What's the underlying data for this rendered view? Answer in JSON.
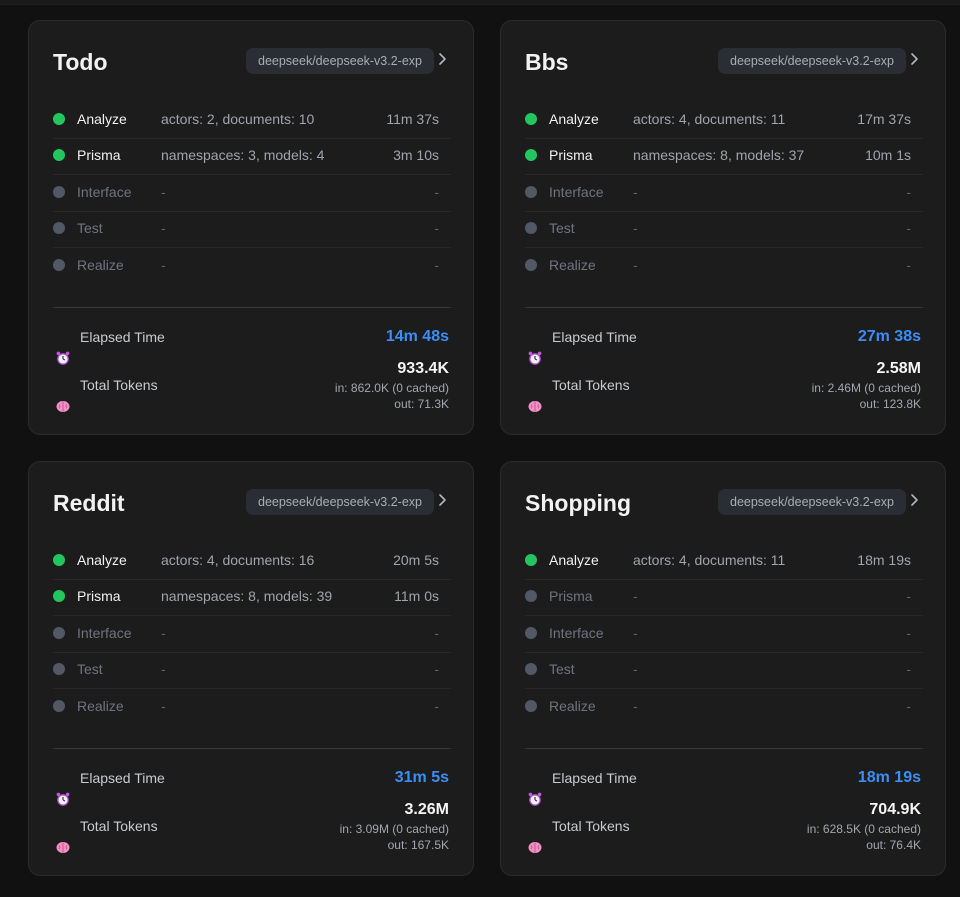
{
  "cards": [
    {
      "title": "Todo",
      "model": "deepseek/deepseek-v3.2-exp",
      "phases": [
        {
          "name": "Analyze",
          "detail": "actors: 2, documents: 10",
          "time": "11m 37s",
          "status": "done"
        },
        {
          "name": "Prisma",
          "detail": "namespaces: 3, models: 4",
          "time": "3m 10s",
          "status": "done"
        },
        {
          "name": "Interface",
          "detail": "-",
          "time": "-",
          "status": "pending"
        },
        {
          "name": "Test",
          "detail": "-",
          "time": "-",
          "status": "pending"
        },
        {
          "name": "Realize",
          "detail": "-",
          "time": "-",
          "status": "pending"
        }
      ],
      "elapsed_label": "Elapsed Time",
      "elapsed": "14m 48s",
      "tokens_label": "Total Tokens",
      "tokens_total": "933.4K",
      "tokens_in": "in: 862.0K (0 cached)",
      "tokens_out": "out: 71.3K"
    },
    {
      "title": "Bbs",
      "model": "deepseek/deepseek-v3.2-exp",
      "phases": [
        {
          "name": "Analyze",
          "detail": "actors: 4, documents: 11",
          "time": "17m 37s",
          "status": "done"
        },
        {
          "name": "Prisma",
          "detail": "namespaces: 8, models: 37",
          "time": "10m 1s",
          "status": "done"
        },
        {
          "name": "Interface",
          "detail": "-",
          "time": "-",
          "status": "pending"
        },
        {
          "name": "Test",
          "detail": "-",
          "time": "-",
          "status": "pending"
        },
        {
          "name": "Realize",
          "detail": "-",
          "time": "-",
          "status": "pending"
        }
      ],
      "elapsed_label": "Elapsed Time",
      "elapsed": "27m 38s",
      "tokens_label": "Total Tokens",
      "tokens_total": "2.58M",
      "tokens_in": "in: 2.46M (0 cached)",
      "tokens_out": "out: 123.8K"
    },
    {
      "title": "Reddit",
      "model": "deepseek/deepseek-v3.2-exp",
      "phases": [
        {
          "name": "Analyze",
          "detail": "actors: 4, documents: 16",
          "time": "20m 5s",
          "status": "done"
        },
        {
          "name": "Prisma",
          "detail": "namespaces: 8, models: 39",
          "time": "11m 0s",
          "status": "done"
        },
        {
          "name": "Interface",
          "detail": "-",
          "time": "-",
          "status": "pending"
        },
        {
          "name": "Test",
          "detail": "-",
          "time": "-",
          "status": "pending"
        },
        {
          "name": "Realize",
          "detail": "-",
          "time": "-",
          "status": "pending"
        }
      ],
      "elapsed_label": "Elapsed Time",
      "elapsed": "31m 5s",
      "tokens_label": "Total Tokens",
      "tokens_total": "3.26M",
      "tokens_in": "in: 3.09M (0 cached)",
      "tokens_out": "out: 167.5K"
    },
    {
      "title": "Shopping",
      "model": "deepseek/deepseek-v3.2-exp",
      "phases": [
        {
          "name": "Analyze",
          "detail": "actors: 4, documents: 11",
          "time": "18m 19s",
          "status": "done"
        },
        {
          "name": "Prisma",
          "detail": "-",
          "time": "-",
          "status": "pending"
        },
        {
          "name": "Interface",
          "detail": "-",
          "time": "-",
          "status": "pending"
        },
        {
          "name": "Test",
          "detail": "-",
          "time": "-",
          "status": "pending"
        },
        {
          "name": "Realize",
          "detail": "-",
          "time": "-",
          "status": "pending"
        }
      ],
      "elapsed_label": "Elapsed Time",
      "elapsed": "18m 19s",
      "tokens_label": "Total Tokens",
      "tokens_total": "704.9K",
      "tokens_in": "in: 628.5K (0 cached)",
      "tokens_out": "out: 76.4K"
    }
  ],
  "colors": {
    "done": "#22c55e",
    "pending": "#525866",
    "elapsed_accent": "#3b8ef5"
  },
  "icons": {
    "elapsed": "alarm-clock-icon",
    "tokens": "brain-icon",
    "open": "chevron-right-icon"
  }
}
